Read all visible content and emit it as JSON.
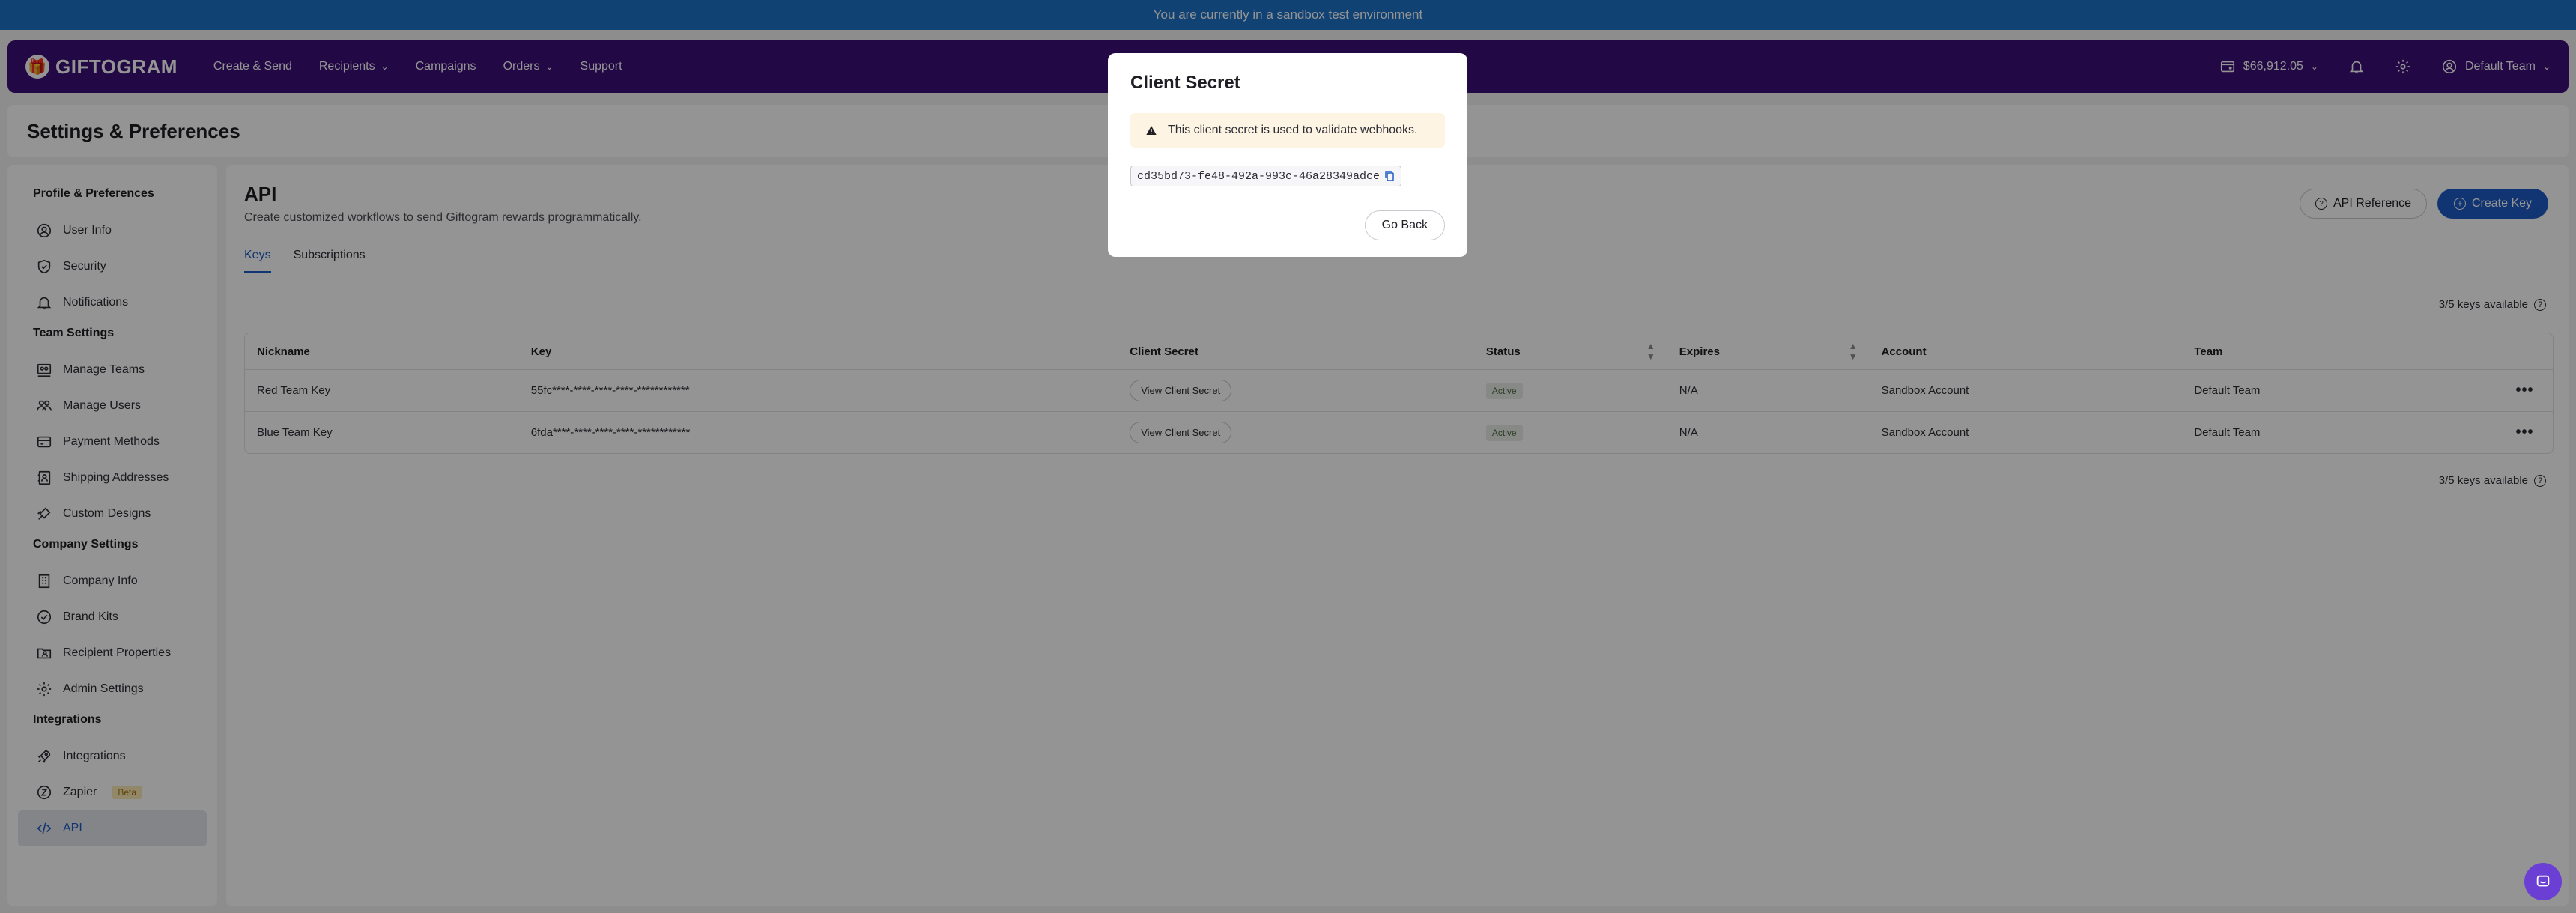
{
  "banner": {
    "text": "You are currently in a sandbox test environment"
  },
  "nav": {
    "logo": "GIFTOGRAM",
    "items": [
      {
        "label": "Create & Send",
        "dropdown": false
      },
      {
        "label": "Recipients",
        "dropdown": true
      },
      {
        "label": "Campaigns",
        "dropdown": false
      },
      {
        "label": "Orders",
        "dropdown": true
      },
      {
        "label": "Support",
        "dropdown": false
      }
    ],
    "balance": "$66,912.05",
    "team": "Default Team"
  },
  "page": {
    "title": "Settings & Preferences"
  },
  "sidebar": {
    "sections": [
      {
        "title": "Profile & Preferences",
        "items": [
          {
            "label": "User Info",
            "icon": "user-circle-icon"
          },
          {
            "label": "Security",
            "icon": "shield-check-icon"
          },
          {
            "label": "Notifications",
            "icon": "bell-icon"
          }
        ]
      },
      {
        "title": "Team Settings",
        "items": [
          {
            "label": "Manage Teams",
            "icon": "teams-board-icon"
          },
          {
            "label": "Manage Users",
            "icon": "users-icon"
          },
          {
            "label": "Payment Methods",
            "icon": "credit-card-icon"
          },
          {
            "label": "Shipping Addresses",
            "icon": "address-book-icon"
          },
          {
            "label": "Custom Designs",
            "icon": "design-brush-icon"
          }
        ]
      },
      {
        "title": "Company Settings",
        "items": [
          {
            "label": "Company Info",
            "icon": "building-icon"
          },
          {
            "label": "Brand Kits",
            "icon": "badge-check-icon"
          },
          {
            "label": "Recipient Properties",
            "icon": "folder-user-icon"
          },
          {
            "label": "Admin Settings",
            "icon": "gear-icon"
          }
        ]
      },
      {
        "title": "Integrations",
        "items": [
          {
            "label": "Integrations",
            "icon": "rocket-icon"
          },
          {
            "label": "Zapier",
            "icon": "zapier-icon",
            "badge": "Beta"
          },
          {
            "label": "API",
            "icon": "code-icon",
            "active": true
          }
        ]
      }
    ]
  },
  "api": {
    "title": "API",
    "subtitle": "Create customized workflows to send Giftogram rewards programmatically.",
    "reference_label": "API Reference",
    "create_label": "Create Key",
    "tabs": [
      {
        "label": "Keys",
        "active": true
      },
      {
        "label": "Subscriptions",
        "active": false
      }
    ],
    "keys_available": "3/5 keys available",
    "columns": [
      "Nickname",
      "Key",
      "Client Secret",
      "Status",
      "Expires",
      "Account",
      "Team"
    ],
    "rows": [
      {
        "nickname": "Red Team Key",
        "key": "55fc****-****-****-****-************",
        "secret_btn": "View Client Secret",
        "status": "Active",
        "expires": "N/A",
        "account": "Sandbox Account",
        "team": "Default Team"
      },
      {
        "nickname": "Blue Team Key",
        "key": "6fda****-****-****-****-************",
        "secret_btn": "View Client Secret",
        "status": "Active",
        "expires": "N/A",
        "account": "Sandbox Account",
        "team": "Default Team"
      }
    ]
  },
  "modal": {
    "title": "Client Secret",
    "warning": "This client secret is used to validate webhooks.",
    "secret": "cd35bd73-fe48-492a-993c-46a28349adce",
    "back_label": "Go Back"
  },
  "colors": {
    "brand": "#3b0f78",
    "accent": "#1e5bc6",
    "banner": "#1e73c8",
    "chat": "#6b3fd3"
  }
}
